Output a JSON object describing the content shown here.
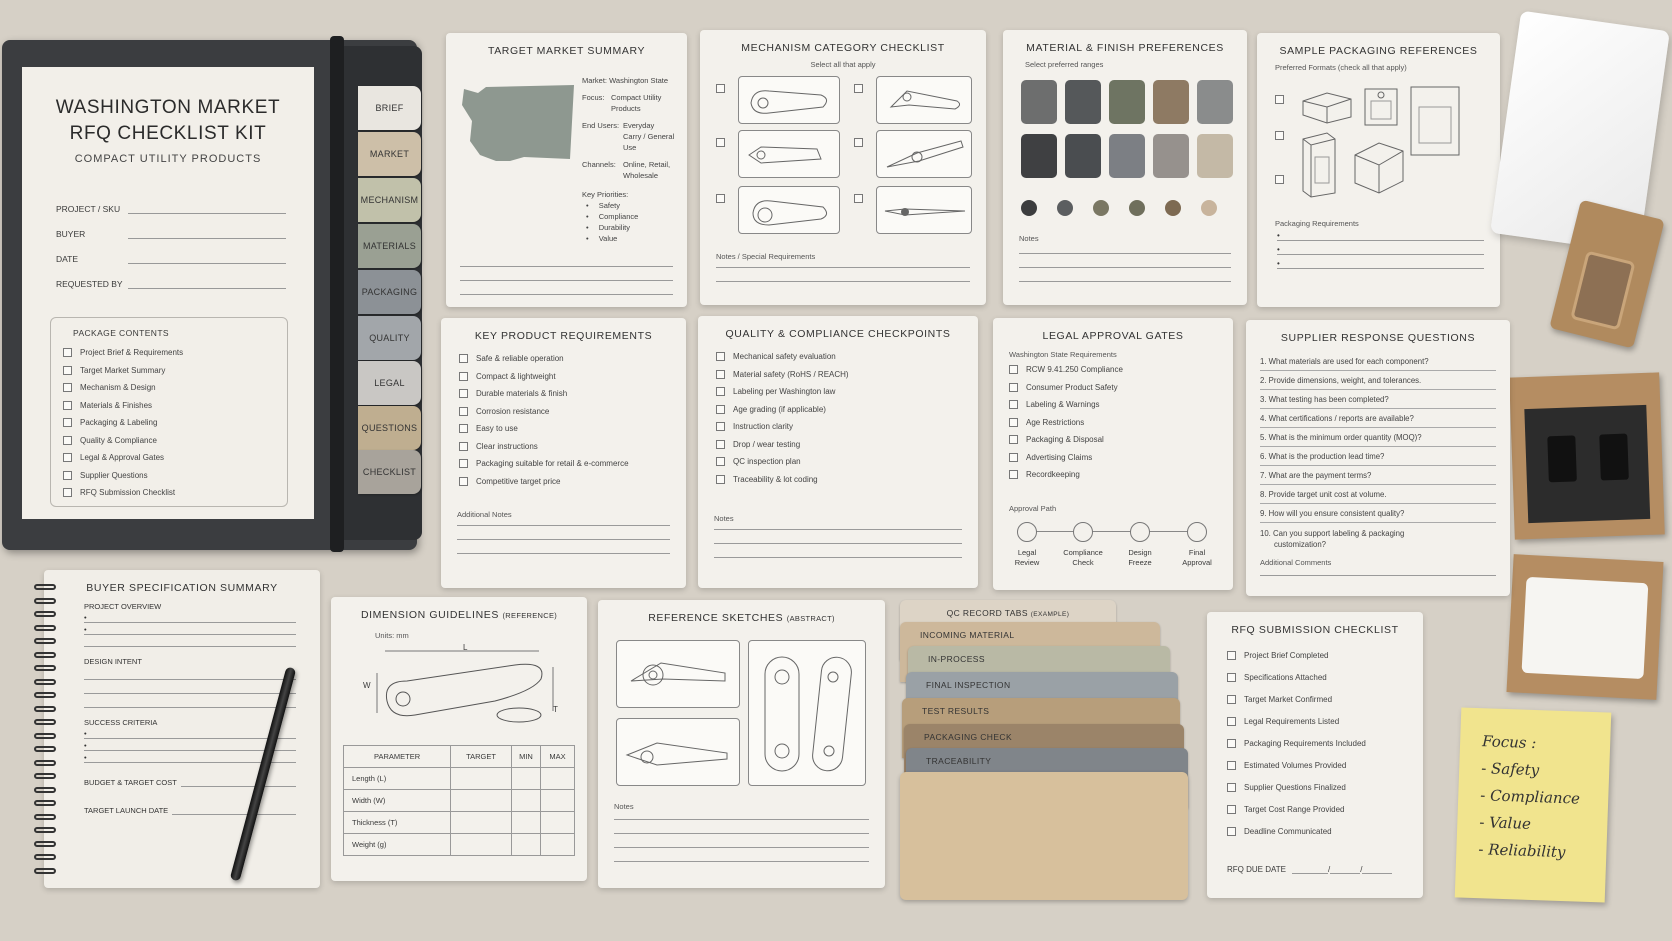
{
  "binder": {
    "title1": "WASHINGTON MARKET",
    "title2": "RFQ CHECKLIST KIT",
    "subtitle": "COMPACT UTILITY PRODUCTS",
    "fields": [
      "PROJECT / SKU",
      "BUYER",
      "DATE",
      "REQUESTED BY"
    ],
    "contents_title": "PACKAGE CONTENTS",
    "contents": [
      "Project Brief & Requirements",
      "Target Market Summary",
      "Mechanism & Design",
      "Materials & Finishes",
      "Packaging & Labeling",
      "Quality & Compliance",
      "Legal & Approval Gates",
      "Supplier Questions",
      "RFQ Submission Checklist"
    ],
    "tabs": [
      "BRIEF",
      "MARKET",
      "MECHANISM",
      "MATERIALS",
      "PACKAGING",
      "QUALITY",
      "LEGAL",
      "QUESTIONS",
      "CHECKLIST"
    ]
  },
  "market": {
    "title": "TARGET MARKET SUMMARY",
    "market_label": "Market:",
    "market_value": "Washington State",
    "focus_label": "Focus:",
    "focus_value1": "Compact Utility",
    "focus_value2": "Products",
    "users_label": "End Users:",
    "users_value1": "Everyday",
    "users_value2": "Carry / General Use",
    "channels_label": "Channels:",
    "channels_value1": "Online, Retail,",
    "channels_value2": "Wholesale",
    "priorities_label": "Key Priorities:",
    "priorities": [
      "Safety",
      "Compliance",
      "Durability",
      "Value"
    ]
  },
  "mechanism": {
    "title": "MECHANISM CATEGORY CHECKLIST",
    "subtitle": "Select all that apply",
    "notes": "Notes / Special Requirements"
  },
  "materials": {
    "title": "MATERIAL & FINISH PREFERENCES",
    "subtitle": "Select preferred ranges",
    "notes": "Notes",
    "swatches1": [
      "#6d6e6e",
      "#55585a",
      "#6e7462",
      "#8e7a63",
      "#8a8c8c"
    ],
    "swatches2": [
      "#3f4042",
      "#4a4d50",
      "#7c7f84",
      "#96918d",
      "#c4b9a6"
    ],
    "dots": [
      "#3c3d3e",
      "#5b5e60",
      "#7a7763",
      "#6f6f5c",
      "#7d6a52",
      "#c8b49c"
    ]
  },
  "packaging": {
    "title": "SAMPLE PACKAGING REFERENCES",
    "subtitle": "Preferred Formats (check all that apply)",
    "req": "Packaging Requirements"
  },
  "requirements": {
    "title": "KEY PRODUCT REQUIREMENTS",
    "items": [
      "Safe & reliable operation",
      "Compact & lightweight",
      "Durable materials & finish",
      "Corrosion resistance",
      "Easy to use",
      "Clear instructions",
      "Packaging suitable for retail & e-commerce",
      "Competitive target price"
    ],
    "notes": "Additional Notes"
  },
  "quality": {
    "title": "QUALITY & COMPLIANCE CHECKPOINTS",
    "items": [
      "Mechanical safety evaluation",
      "Material safety (RoHS / REACH)",
      "Labeling per Washington law",
      "Age grading (if applicable)",
      "Instruction clarity",
      "Drop / wear testing",
      "QC inspection plan",
      "Traceability & lot coding"
    ],
    "notes": "Notes"
  },
  "legal": {
    "title": "LEGAL APPROVAL GATES",
    "subtitle": "Washington State Requirements",
    "items": [
      "RCW 9.41.250 Compliance",
      "Consumer Product Safety",
      "Labeling & Warnings",
      "Age Restrictions",
      "Packaging & Disposal",
      "Advertising Claims",
      "Recordkeeping"
    ],
    "path_label": "Approval Path",
    "path": [
      [
        "Legal",
        "Review"
      ],
      [
        "Compliance",
        "Check"
      ],
      [
        "Design",
        "Freeze"
      ],
      [
        "Final",
        "Approval"
      ]
    ]
  },
  "supplier": {
    "title": "SUPPLIER RESPONSE QUESTIONS",
    "items": [
      "1.  What materials are used for each component?",
      "2.  Provide dimensions, weight, and tolerances.",
      "3.  What testing has been completed?",
      "4.  What certifications / reports are available?",
      "5.  What is the minimum order quantity (MOQ)?",
      "6.  What is the production lead time?",
      "7.  What are the payment terms?",
      "8.  Provide target unit cost at volume.",
      "9.  How will you ensure consistent quality?",
      "10.  Can you support labeling & packaging"
    ],
    "item10b": "customization?",
    "comments": "Additional Comments"
  },
  "buyer": {
    "title": "BUYER SPECIFICATION SUMMARY",
    "sections": [
      "PROJECT OVERVIEW",
      "DESIGN INTENT",
      "SUCCESS CRITERIA"
    ],
    "budget": "BUDGET & TARGET COST",
    "launch": "TARGET LAUNCH DATE"
  },
  "dimension": {
    "title": "DIMENSION GUIDELINES",
    "title_small": "(REFERENCE)",
    "units": "Units: mm",
    "L": "L",
    "W": "W",
    "T": "T",
    "headers": [
      "PARAMETER",
      "TARGET",
      "MIN",
      "MAX"
    ],
    "rows": [
      "Length (L)",
      "Width (W)",
      "Thickness (T)",
      "Weight (g)"
    ]
  },
  "sketches": {
    "title": "REFERENCE SKETCHES",
    "title_small": "(ABSTRACT)",
    "notes": "Notes"
  },
  "qc": {
    "header": "QC RECORD TABS",
    "header_small": "(EXAMPLE)",
    "tabs": [
      "INCOMING MATERIAL",
      "IN-PROCESS",
      "FINAL INSPECTION",
      "TEST RESULTS",
      "PACKAGING CHECK",
      "TRACEABILITY"
    ]
  },
  "rfq": {
    "title": "RFQ SUBMISSION CHECKLIST",
    "items": [
      "Project Brief Completed",
      "Specifications Attached",
      "Target Market Confirmed",
      "Legal Requirements Listed",
      "Packaging Requirements Included",
      "Estimated Volumes Provided",
      "Supplier Questions Finalized",
      "Target Cost Range Provided",
      "Deadline Communicated"
    ],
    "due": "RFQ DUE DATE",
    "slash": "/"
  },
  "sticky": {
    "title": "Focus :",
    "items": [
      "- Safety",
      "- Compliance",
      "- Value",
      "- Reliability"
    ]
  }
}
